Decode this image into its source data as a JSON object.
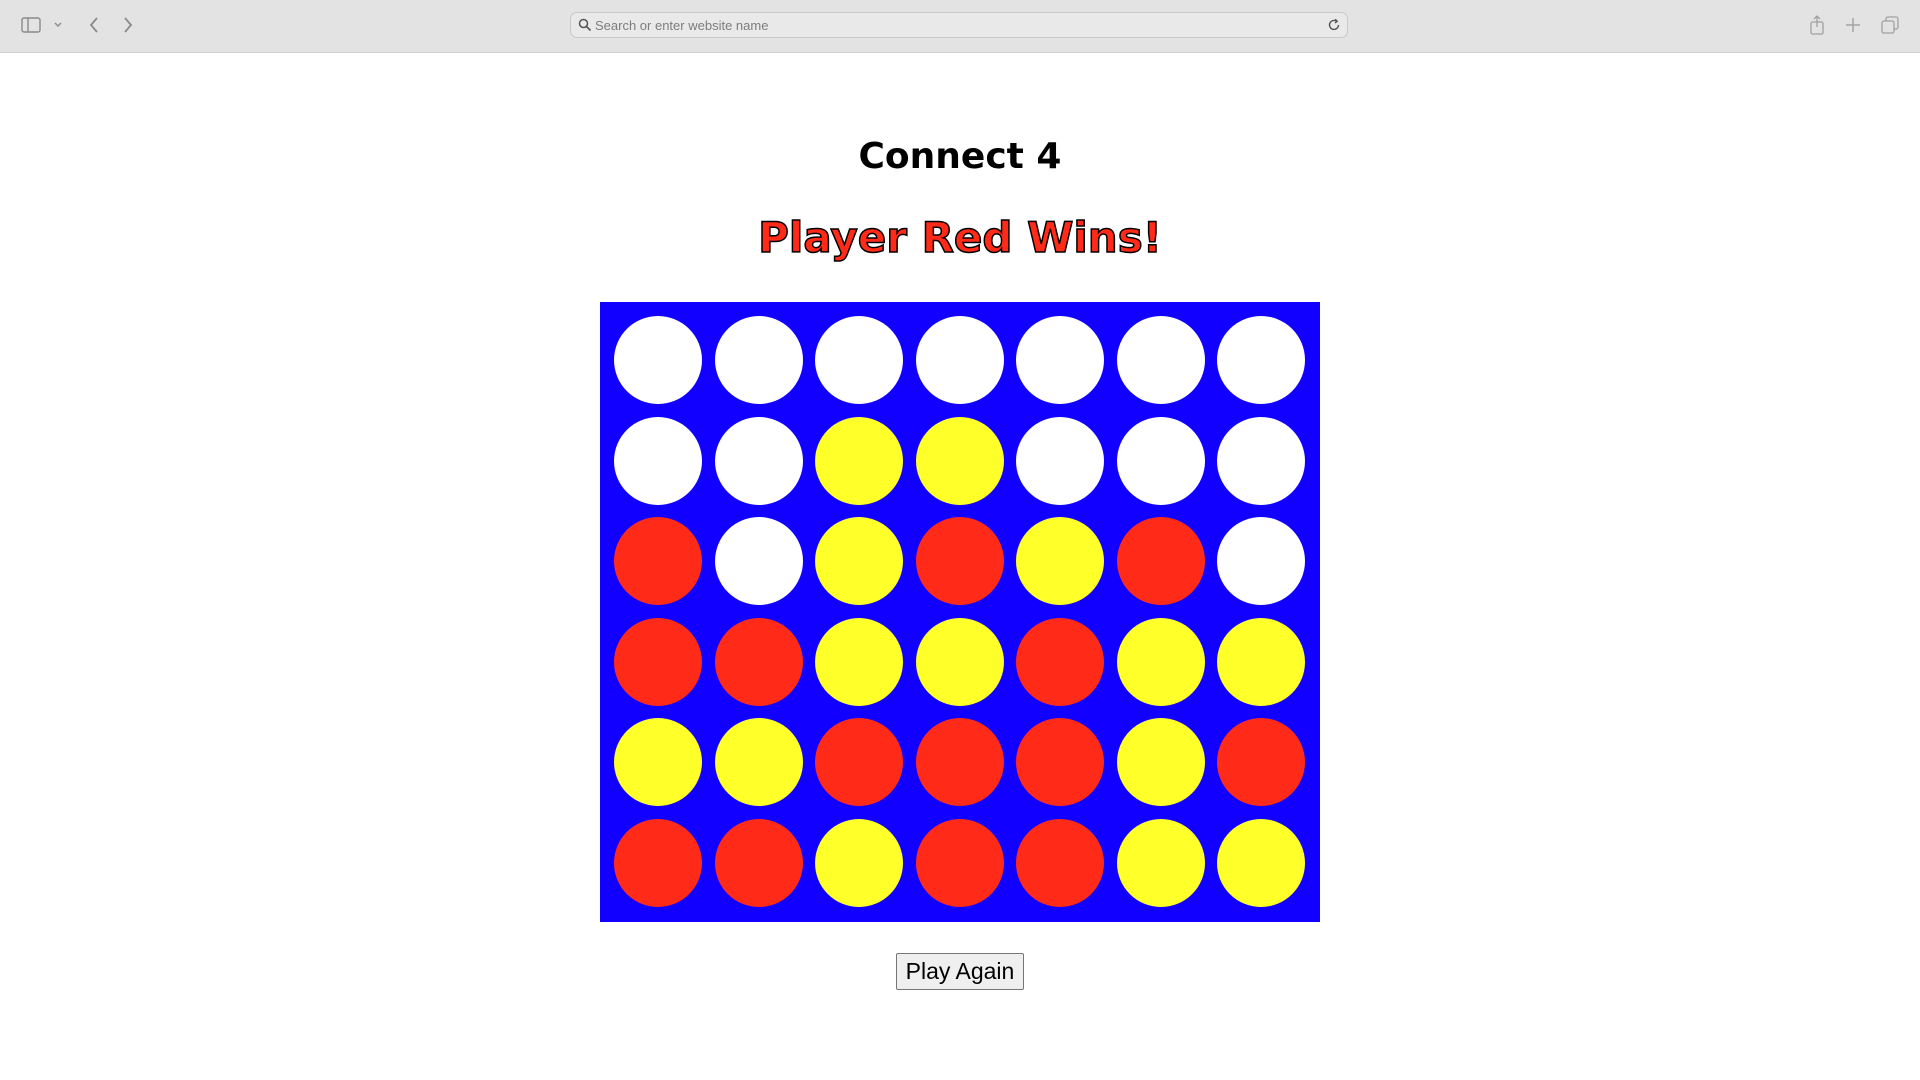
{
  "browser": {
    "address_placeholder": "Search or enter website name",
    "address_value": ""
  },
  "game": {
    "title": "Connect 4",
    "status": "Player Red Wins!",
    "play_again_label": "Play Again",
    "colors": {
      "board": "#1100ff",
      "empty": "#ffffff",
      "red": "#ff2a17",
      "yellow": "#ffff2a"
    },
    "board": [
      [
        "empty",
        "empty",
        "empty",
        "empty",
        "empty",
        "empty",
        "empty"
      ],
      [
        "empty",
        "empty",
        "yellow",
        "yellow",
        "empty",
        "empty",
        "empty"
      ],
      [
        "red",
        "empty",
        "yellow",
        "red",
        "yellow",
        "red",
        "empty"
      ],
      [
        "red",
        "red",
        "yellow",
        "yellow",
        "red",
        "yellow",
        "yellow"
      ],
      [
        "yellow",
        "yellow",
        "red",
        "red",
        "red",
        "yellow",
        "red"
      ],
      [
        "red",
        "red",
        "yellow",
        "red",
        "red",
        "yellow",
        "yellow"
      ]
    ]
  }
}
